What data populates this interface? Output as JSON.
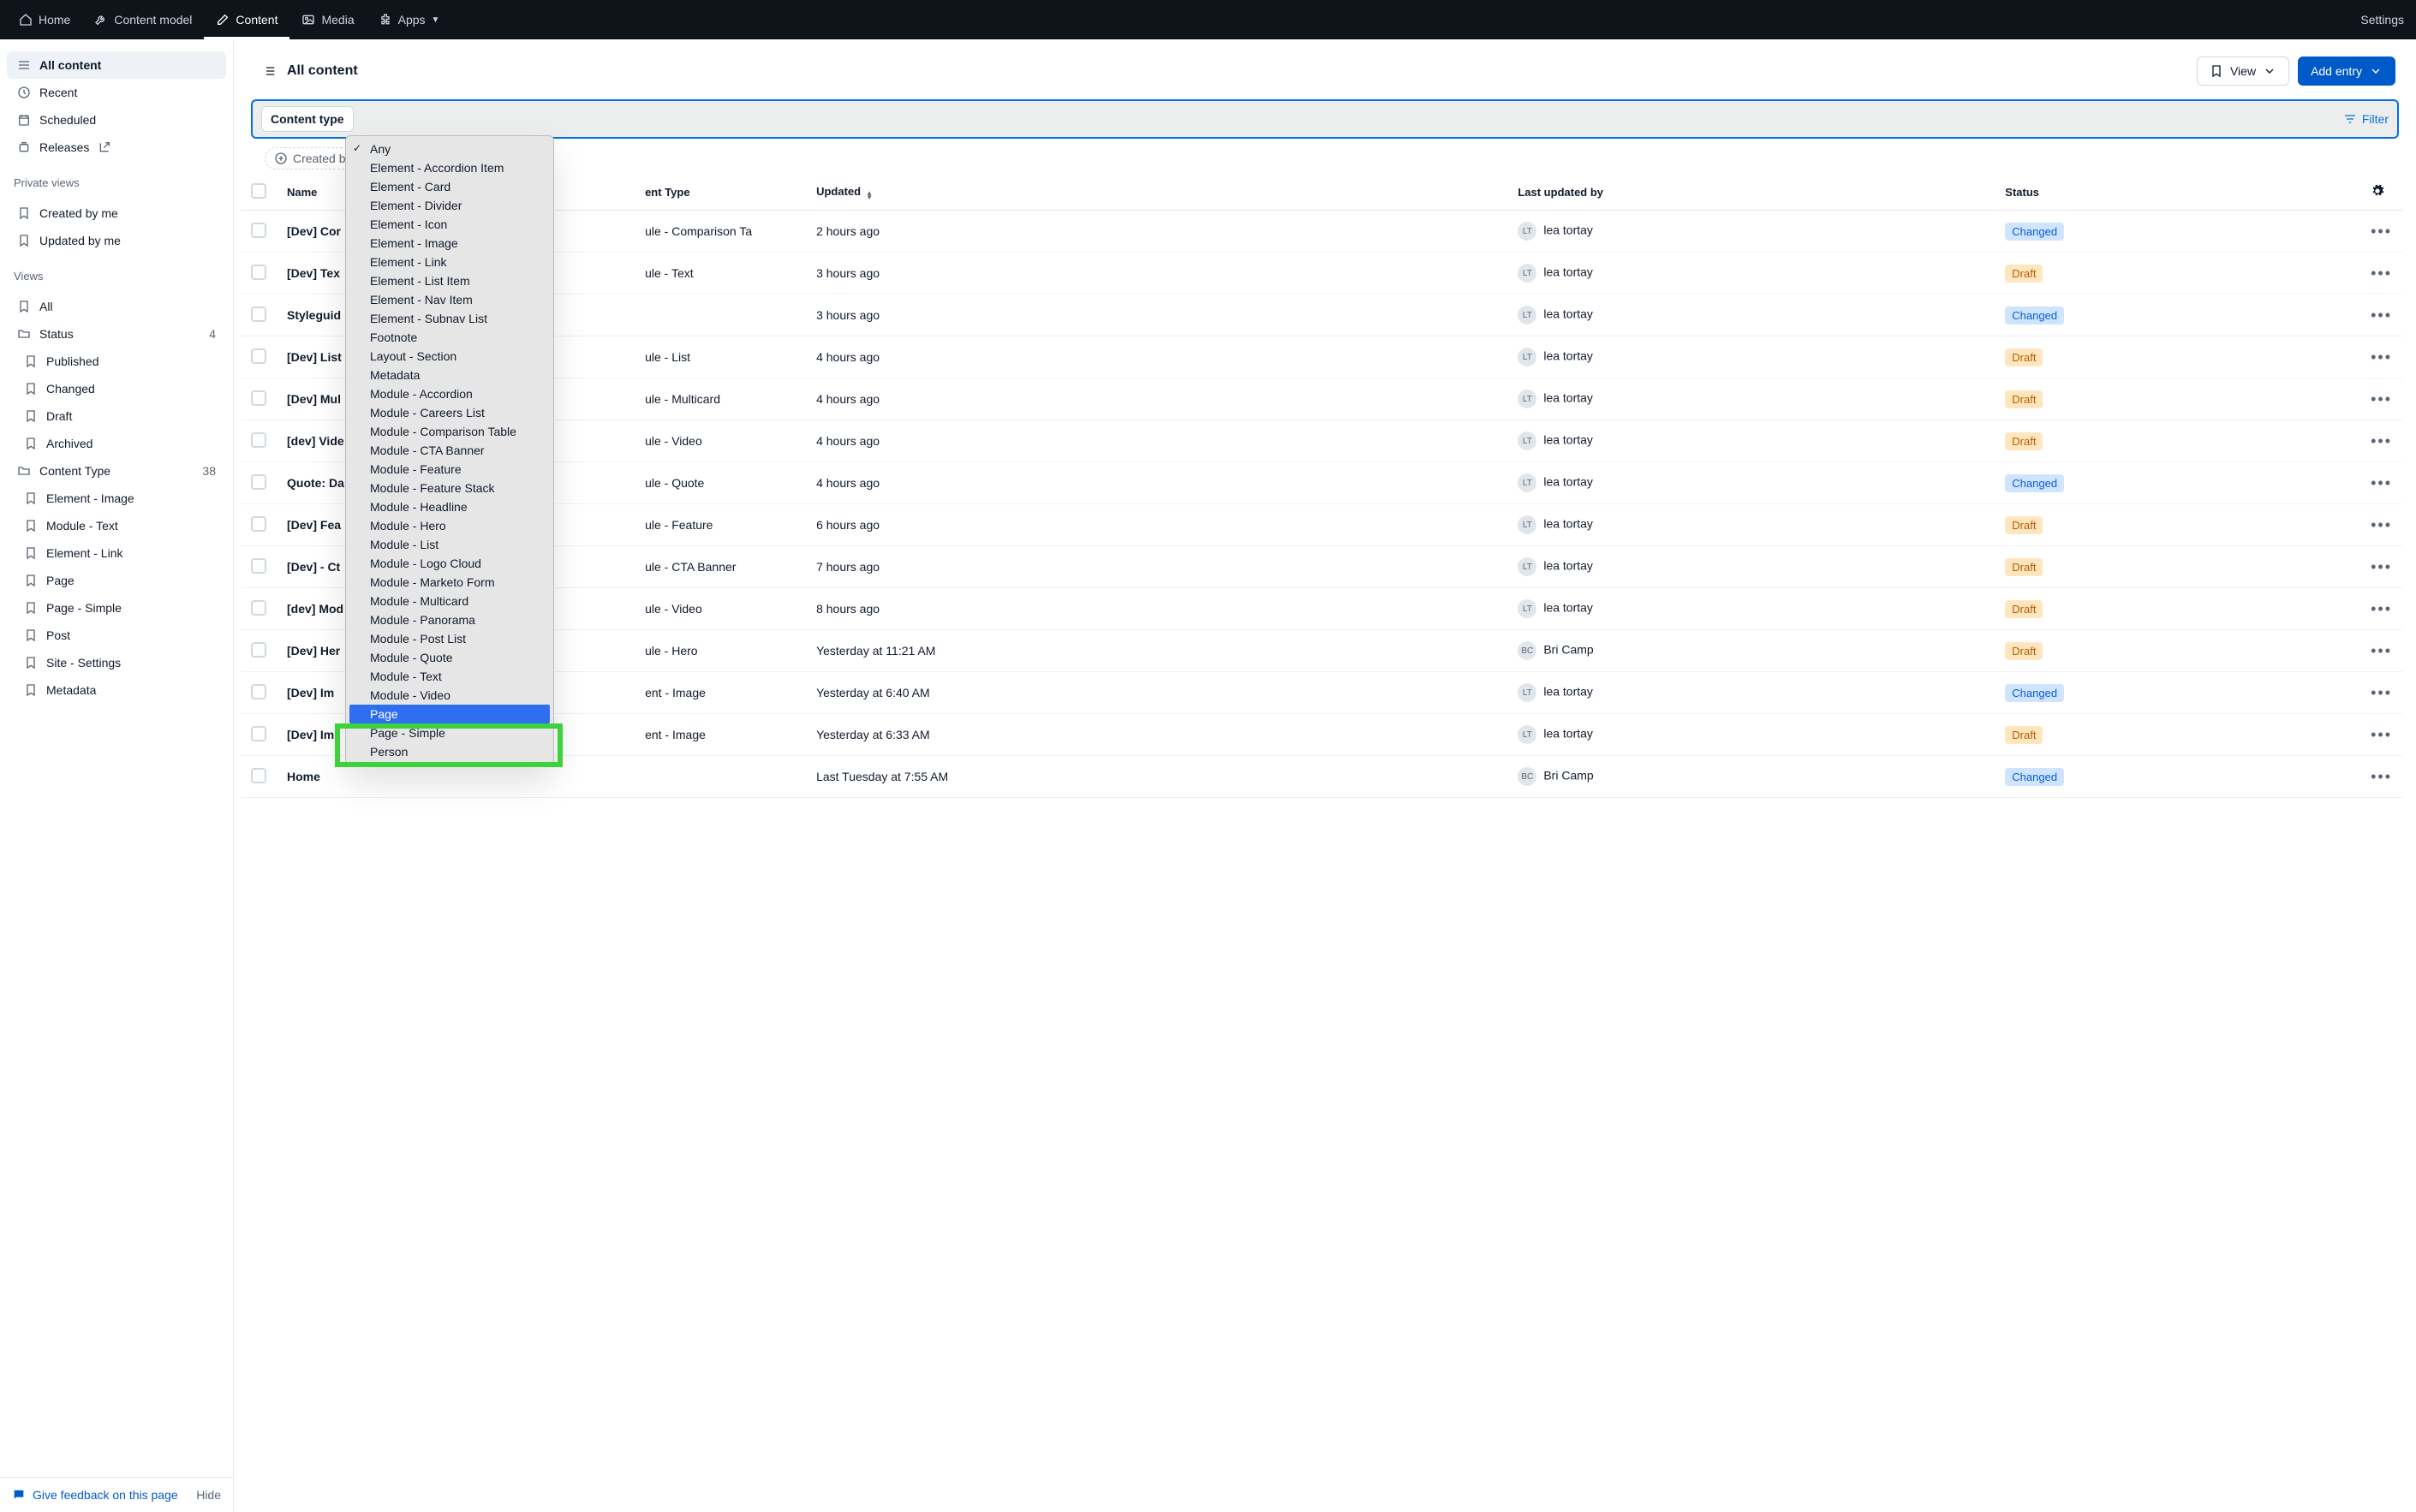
{
  "topnav": {
    "items": [
      {
        "label": "Home",
        "icon": "home"
      },
      {
        "label": "Content model",
        "icon": "wrench"
      },
      {
        "label": "Content",
        "icon": "edit",
        "active": true
      },
      {
        "label": "Media",
        "icon": "image"
      },
      {
        "label": "Apps",
        "icon": "puzzle",
        "caret": true
      }
    ],
    "right": "Settings"
  },
  "sidebar": {
    "top": [
      {
        "label": "All content",
        "icon": "menu",
        "active": true
      },
      {
        "label": "Recent",
        "icon": "clock"
      },
      {
        "label": "Scheduled",
        "icon": "calendar"
      },
      {
        "label": "Releases",
        "icon": "releases",
        "ext": true
      }
    ],
    "private_label": "Private views",
    "private": [
      {
        "label": "Created by me",
        "icon": "bookmark"
      },
      {
        "label": "Updated by me",
        "icon": "bookmark"
      }
    ],
    "views_label": "Views",
    "views": [
      {
        "label": "All",
        "icon": "bookmark"
      },
      {
        "label": "Status",
        "icon": "folder",
        "count": "4",
        "children": [
          {
            "label": "Published"
          },
          {
            "label": "Changed"
          },
          {
            "label": "Draft"
          },
          {
            "label": "Archived"
          }
        ]
      },
      {
        "label": "Content Type",
        "icon": "folder",
        "count": "38",
        "children": [
          {
            "label": "Element - Image"
          },
          {
            "label": "Module - Text"
          },
          {
            "label": "Element - Link"
          },
          {
            "label": "Page"
          },
          {
            "label": "Page - Simple"
          },
          {
            "label": "Post"
          },
          {
            "label": "Site - Settings"
          },
          {
            "label": "Metadata"
          }
        ]
      }
    ],
    "footer": {
      "feedback": "Give feedback on this page",
      "hide": "Hide"
    }
  },
  "main": {
    "title": "All content",
    "view_btn": "View",
    "add_btn": "Add entry",
    "filter_pill": "Content type",
    "filter_right": "Filter",
    "chip": "Created by me",
    "dropdown": [
      "Any",
      "Element - Accordion Item",
      "Element - Card",
      "Element - Divider",
      "Element - Icon",
      "Element - Image",
      "Element - Link",
      "Element - List Item",
      "Element - Nav Item",
      "Element - Subnav List",
      "Footnote",
      "Layout - Section",
      "Metadata",
      "Module - Accordion",
      "Module - Careers List",
      "Module - Comparison Table",
      "Module - CTA Banner",
      "Module - Feature",
      "Module - Feature Stack",
      "Module - Headline",
      "Module - Hero",
      "Module - List",
      "Module - Logo Cloud",
      "Module - Marketo Form",
      "Module - Multicard",
      "Module - Panorama",
      "Module - Post List",
      "Module - Quote",
      "Module - Text",
      "Module - Video",
      "Page",
      "Page - Simple",
      "Person"
    ],
    "dropdown_checked": "Any",
    "dropdown_selected": "Page"
  },
  "table": {
    "cols": [
      "Name",
      "ent Type",
      "Updated",
      "Last updated by",
      "Status"
    ],
    "rows": [
      {
        "name": "[Dev] Cor",
        "ctype": "ule - Comparison Ta",
        "updated": "2 hours ago",
        "by_initials": "LT",
        "by": "lea tortay",
        "status": "Changed"
      },
      {
        "name": "[Dev] Tex",
        "ctype": "ule - Text",
        "updated": "3 hours ago",
        "by_initials": "LT",
        "by": "lea tortay",
        "status": "Draft"
      },
      {
        "name": "Styleguid",
        "ctype": "",
        "updated": "3 hours ago",
        "by_initials": "LT",
        "by": "lea tortay",
        "status": "Changed"
      },
      {
        "name": "[Dev] List",
        "ctype": "ule - List",
        "updated": "4 hours ago",
        "by_initials": "LT",
        "by": "lea tortay",
        "status": "Draft"
      },
      {
        "name": "[Dev] Mul",
        "ctype": "ule - Multicard",
        "updated": "4 hours ago",
        "by_initials": "LT",
        "by": "lea tortay",
        "status": "Draft"
      },
      {
        "name": "[dev] Vide",
        "ctype": "ule - Video",
        "updated": "4 hours ago",
        "by_initials": "LT",
        "by": "lea tortay",
        "status": "Draft"
      },
      {
        "name": "Quote: Da",
        "ctype": "ule - Quote",
        "updated": "4 hours ago",
        "by_initials": "LT",
        "by": "lea tortay",
        "status": "Changed"
      },
      {
        "name": "[Dev] Fea",
        "ctype": "ule - Feature",
        "updated": "6 hours ago",
        "by_initials": "LT",
        "by": "lea tortay",
        "status": "Draft"
      },
      {
        "name": "[Dev] - Ct",
        "ctype": "ule - CTA Banner",
        "updated": "7 hours ago",
        "by_initials": "LT",
        "by": "lea tortay",
        "status": "Draft"
      },
      {
        "name": "[dev] Mod",
        "ctype": "ule - Video",
        "updated": "8 hours ago",
        "by_initials": "LT",
        "by": "lea tortay",
        "status": "Draft"
      },
      {
        "name": "[Dev] Her",
        "ctype": "ule - Hero",
        "updated": "Yesterday at 11:21 AM",
        "by_initials": "BC",
        "by": "Bri Camp",
        "status": "Draft"
      },
      {
        "name": "[Dev] Im",
        "ctype": "ent - Image",
        "updated": "Yesterday at 6:40 AM",
        "by_initials": "LT",
        "by": "lea tortay",
        "status": "Changed"
      },
      {
        "name": "[Dev] Im",
        "ctype": "ent - Image",
        "updated": "Yesterday at 6:33 AM",
        "by_initials": "LT",
        "by": "lea tortay",
        "status": "Draft"
      },
      {
        "name": "Home",
        "ctype": "",
        "updated": "Last Tuesday at 7:55 AM",
        "by_initials": "BC",
        "by": "Bri Camp",
        "status": "Changed"
      }
    ]
  }
}
